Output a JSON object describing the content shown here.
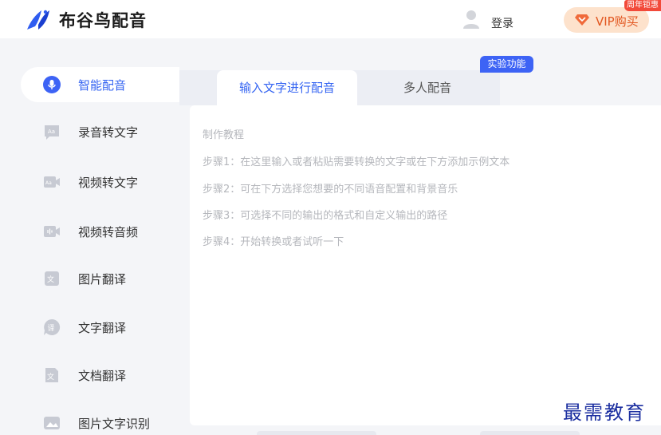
{
  "app": {
    "title": "布谷鸟配音"
  },
  "header": {
    "login_label": "登录",
    "vip_label": "VIP购买",
    "promo_badge": "周年钜惠",
    "brand_color": "#3464f2"
  },
  "sidebar": {
    "items": [
      {
        "label": "智能配音",
        "icon": "mic-icon",
        "active": true
      },
      {
        "label": "录音转文字",
        "icon": "audio-text-icon",
        "active": false
      },
      {
        "label": "视频转文字",
        "icon": "video-text-icon",
        "active": false
      },
      {
        "label": "视频转音频",
        "icon": "video-audio-icon",
        "active": false
      },
      {
        "label": "图片翻译",
        "icon": "image-translate-icon",
        "active": false
      },
      {
        "label": "文字翻译",
        "icon": "text-translate-icon",
        "active": false
      },
      {
        "label": "文档翻译",
        "icon": "document-translate-icon",
        "active": false
      },
      {
        "label": "图片文字识别",
        "icon": "image-ocr-icon",
        "active": false
      }
    ]
  },
  "tabs": {
    "items": [
      {
        "label": "输入文字进行配音",
        "active": true
      },
      {
        "label": "多人配音",
        "active": false
      }
    ],
    "lab_badge": "实验功能"
  },
  "editor": {
    "tutorial_title": "制作教程",
    "steps": [
      "步骤1：在这里输入或者粘贴需要转换的文字或在下方添加示例文本",
      "步骤2：可在下方选择您想要的不同语音配置和背景音乐",
      "步骤3：可选择不同的输出的格式和自定义输出的路径",
      "步骤4：开始转换或者试听一下"
    ]
  },
  "watermark": "最需教育"
}
